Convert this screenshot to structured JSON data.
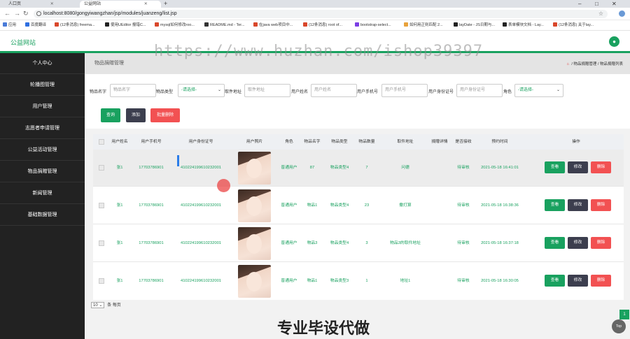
{
  "browser": {
    "tabs": [
      {
        "title": "人口页",
        "active": false
      },
      {
        "title": "公益网站",
        "active": true
      }
    ],
    "new_tab": "+",
    "url": "localhost:8080/gongyiwangzhan/jsp/modules/juanzeng/list.jsp",
    "bookmarks": [
      "应用",
      "百度翻译",
      "(12条消息) freema...",
      "使用UEditor 报错C...",
      "mysql如何修改roo...",
      "README.md - Ter...",
      "在java web项目中...",
      "(12条消息) root of...",
      "bootstrap-select...",
      "如何用正则匹配 2...",
      "layDate - JS日期与...",
      "表单模块文档 - Lay...",
      "(12条消息) 关于lay..."
    ]
  },
  "header": {
    "brand": "公益网站",
    "user_icon": "user-icon"
  },
  "sidebar": {
    "items": [
      {
        "label": "个人中心"
      },
      {
        "label": "轮播图管理"
      },
      {
        "label": "用户管理"
      },
      {
        "label": "志愿者申请管理"
      },
      {
        "label": "公益活动管理"
      },
      {
        "label": "物品捐赠管理"
      },
      {
        "label": "新闻管理"
      },
      {
        "label": "基础数据管理"
      }
    ]
  },
  "page": {
    "title": "物品捐赠管理",
    "breadcrumb": {
      "parent": "物品捐赠管理",
      "current": "物品捐赠列表",
      "separator": "/"
    }
  },
  "search": {
    "item_name_label": "物品名字",
    "item_name_placeholder": "物品名字",
    "item_type_label": "物品类型",
    "item_type_value": "-请选择-",
    "pickup_label": "取件地址",
    "pickup_placeholder": "取件地址",
    "username_label": "用户姓名",
    "username_placeholder": "用户姓名",
    "phone_label": "用户手机号",
    "phone_placeholder": "用户手机号",
    "idcard_label": "用户身份证号",
    "idcard_placeholder": "用户身份证号",
    "role_label": "角色",
    "role_value": "-请选择-",
    "query_button": "查询",
    "add_button": "添加",
    "batch_delete_button": "批量删除"
  },
  "table": {
    "columns": [
      "用户姓名",
      "用户手机号",
      "用户身份证号",
      "用户照片",
      "角色",
      "物品名字",
      "物品类型",
      "物品数量",
      "取件地址",
      "捐赠详情",
      "是否接收",
      "预约时间",
      "操作"
    ],
    "rows": [
      {
        "name": "张1",
        "phone": "17703786901",
        "idcard": "410224199610232001",
        "role": "普通用户",
        "item": "87",
        "type": "物品类型4",
        "qty": "7",
        "address": "问德",
        "detail": "",
        "status": "待审核",
        "time": "2021-05-18 16:41:01",
        "highlight": true
      },
      {
        "name": "张1",
        "phone": "17703786901",
        "idcard": "410224199610232001",
        "role": "普通用户",
        "item": "物品1",
        "type": "物品类型4",
        "qty": "23",
        "address": "撒打算",
        "detail": "",
        "status": "待审核",
        "time": "2021-05-18 16:38:36",
        "highlight": false
      },
      {
        "name": "张1",
        "phone": "17703786901",
        "idcard": "410224199610232001",
        "role": "普通用户",
        "item": "物品3",
        "type": "物品类型4",
        "qty": "3",
        "address": "物品3的取件地址",
        "detail": "",
        "status": "待审核",
        "time": "2021-05-18 16:37:18",
        "highlight": false
      },
      {
        "name": "张1",
        "phone": "17703786901",
        "idcard": "410224199610232001",
        "role": "普通用户",
        "item": "物品1",
        "type": "物品类型3",
        "qty": "1",
        "address": "地址1",
        "detail": "",
        "status": "待审核",
        "time": "2021-05-18 16:30:05",
        "highlight": false
      }
    ],
    "actions": {
      "view": "查看",
      "edit": "修改",
      "delete": "删除"
    }
  },
  "pager": {
    "page_size": "10",
    "per_page_label": "条 每页",
    "current_page": "1"
  },
  "top_button": "Top",
  "watermark": "https://www.huzhan.com/ishop39397",
  "caption": "专业毕设代做",
  "colors": {
    "accent": "#19a15f",
    "danger": "#f25152",
    "dark": "#3c3e4e",
    "sidebar": "#222222"
  }
}
